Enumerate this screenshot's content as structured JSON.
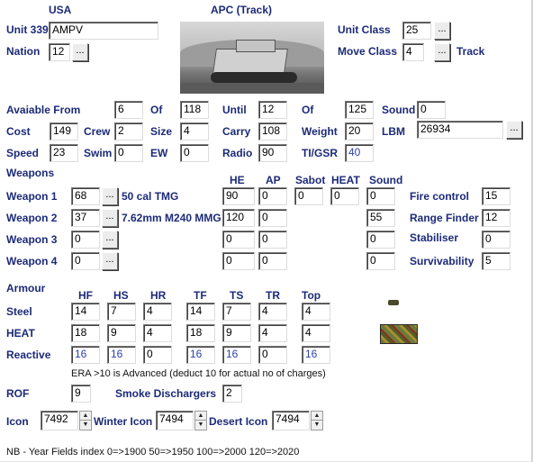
{
  "header": {
    "nation_name": "USA",
    "unit_type": "APC (Track)"
  },
  "unit": {
    "label": "Unit 339",
    "name": "AMPV",
    "nation_label": "Nation",
    "nation": "12",
    "unit_class_label": "Unit Class",
    "unit_class": "25",
    "move_class_label": "Move Class",
    "move_class": "4",
    "move_class_name": "Track"
  },
  "stats": {
    "avail_from_label": "Avaiable From",
    "avail_from_month": "6",
    "of_label": "Of",
    "avail_from_year": "118",
    "until_label": "Until",
    "until_month": "12",
    "of2_label": "Of",
    "until_year": "125",
    "sound_label": "Sound",
    "sound": "0",
    "cost_label": "Cost",
    "cost": "149",
    "crew_label": "Crew",
    "crew": "2",
    "size_label": "Size",
    "size": "4",
    "carry_label": "Carry",
    "carry": "108",
    "weight_label": "Weight",
    "weight": "20",
    "lbm_label": "LBM",
    "lbm": "26934",
    "speed_label": "Speed",
    "speed": "23",
    "swim_label": "Swim",
    "swim": "0",
    "ew_label": "EW",
    "ew": "0",
    "radio_label": "Radio",
    "radio": "90",
    "tigsr_label": "TI/GSR",
    "tigsr": "40"
  },
  "weapons": {
    "section_label": "Weapons",
    "col_he": "HE",
    "col_ap": "AP",
    "col_sabot": "Sabot",
    "col_heat": "HEAT",
    "col_sound": "Sound",
    "rows": [
      {
        "label": "Weapon 1",
        "id": "68",
        "name": "50 cal TMG",
        "he": "90",
        "ap": "0",
        "sabot": "0",
        "heat": "0",
        "sound": "0"
      },
      {
        "label": "Weapon 2",
        "id": "37",
        "name": "7.62mm M240 MMG",
        "he": "120",
        "ap": "0",
        "sound": "55"
      },
      {
        "label": "Weapon 3",
        "id": "0",
        "name": "",
        "he": "0",
        "ap": "0",
        "sound": "0"
      },
      {
        "label": "Weapon 4",
        "id": "0",
        "name": "",
        "he": "0",
        "ap": "0",
        "sound": "0"
      }
    ],
    "fire_control_label": "Fire control",
    "fire_control": "15",
    "range_finder_label": "Range Finder",
    "range_finder": "12",
    "stabiliser_label": "Stabiliser",
    "stabiliser": "0",
    "survivability_label": "Survivability",
    "survivability": "5"
  },
  "armour": {
    "section_label": "Armour",
    "cols": [
      "HF",
      "HS",
      "HR",
      "TF",
      "TS",
      "TR",
      "Top"
    ],
    "steel_label": "Steel",
    "steel": [
      "14",
      "7",
      "4",
      "14",
      "7",
      "4",
      "4"
    ],
    "heat_label": "HEAT",
    "heat": [
      "18",
      "9",
      "4",
      "18",
      "9",
      "4",
      "4"
    ],
    "reactive_label": "Reactive",
    "reactive": [
      "16",
      "16",
      "0",
      "16",
      "16",
      "0",
      "16"
    ],
    "era_note": "ERA >10 is Advanced (deduct 10 for actual no of charges)"
  },
  "misc": {
    "rof_label": "ROF",
    "rof": "9",
    "smoke_label": "Smoke Dischargers",
    "smoke": "2",
    "icon_label": "Icon",
    "icon": "7492",
    "winter_icon_label": "Winter Icon",
    "winter_icon": "7494",
    "desert_icon_label": "Desert Icon",
    "desert_icon": "7494",
    "footer_note": "NB - Year Fields index 0=>1900 50=>1950 100=>2000 120=>2020"
  },
  "button_label": "...",
  "spin_up": "▲",
  "spin_down": "▼"
}
